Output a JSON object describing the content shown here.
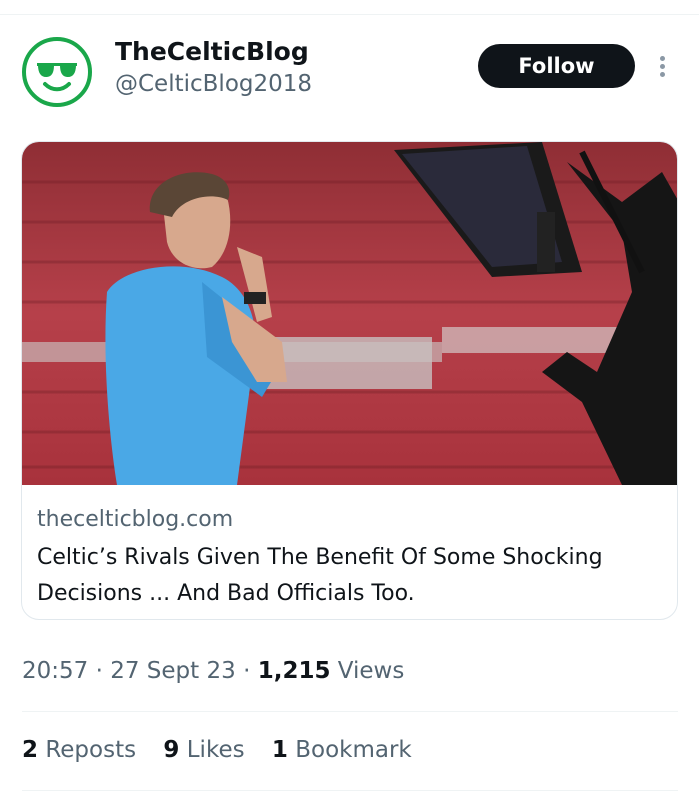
{
  "author": {
    "display_name": "TheCelticBlog",
    "handle": "@CelticBlog2018",
    "avatar_icon": "sunglasses-smiley-icon",
    "avatar_color": "#1aa74a"
  },
  "follow_label": "Follow",
  "more_icon": "more-vertical-icon",
  "link_card": {
    "domain": "thecelticblog.com",
    "title": "Celtic’s Rivals Given The Benefit Of Some Shocking Decisions ... And Bad Officials Too.",
    "image_description_icon": "referee-var-monitor-photo"
  },
  "meta": {
    "time": "20:57",
    "sep1": "·",
    "date": "27 Sept 23",
    "sep2": "·",
    "views_count": "1,215",
    "views_label": "Views"
  },
  "stats": {
    "reposts_count": "2",
    "reposts_label": "Reposts",
    "likes_count": "9",
    "likes_label": "Likes",
    "bookmarks_count": "1",
    "bookmarks_label": "Bookmark"
  },
  "colors": {
    "text_primary": "#0f1419",
    "text_secondary": "#536471",
    "button_bg": "#0f1419",
    "divider": "#eff3f4"
  }
}
